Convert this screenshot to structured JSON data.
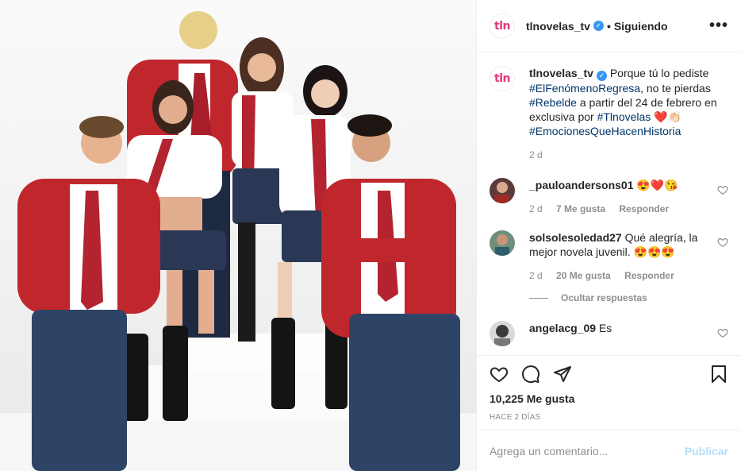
{
  "post": {
    "image_description_alt": "",
    "account": {
      "avatar_text": "tln",
      "username": "tlnovelas_tv",
      "separator": "•",
      "follow_status": "Siguiendo",
      "more_label": "•••"
    },
    "caption": {
      "username": "tlnovelas_tv",
      "text_1": "Porque tú lo pediste",
      "tag_1": "#ElFenómenoRegresa",
      "text_2": ", no te pierdas",
      "tag_2": "#Rebelde",
      "text_3": " a partir del 24 de febrero en exclusiva por ",
      "tag_3": "#Tlnovelas",
      "emojis": "❤️👏🏻",
      "tag_4": "#EmocionesQueHacenHistoria",
      "age": "2 d"
    },
    "comments": [
      {
        "username": "_pauloandersons01",
        "text": "😍❤️😘",
        "age": "2 d",
        "likes": "7 Me gusta",
        "reply": "Responder"
      },
      {
        "username": "solsolesoledad27",
        "text": "Qué alegría, la mejor novela juvenil. 😍😍😍",
        "age": "2 d",
        "likes": "20 Me gusta",
        "reply": "Responder"
      },
      {
        "username": "angelacg_09",
        "text": "Es"
      }
    ],
    "hide_replies": "Ocultar respuestas",
    "likes_count": "10,225 Me gusta",
    "posted_ago": "HACE 2 DÍAS",
    "comment_input_placeholder": "Agrega un comentario...",
    "publish_label": "Publicar"
  },
  "colors": {
    "brand_pink": "#e5397a",
    "verified_blue": "#3897f0",
    "hashtag": "#003569",
    "muted": "#8e8e8e",
    "publish_disabled": "#b2dffc",
    "blazer_red": "#c0272d"
  }
}
